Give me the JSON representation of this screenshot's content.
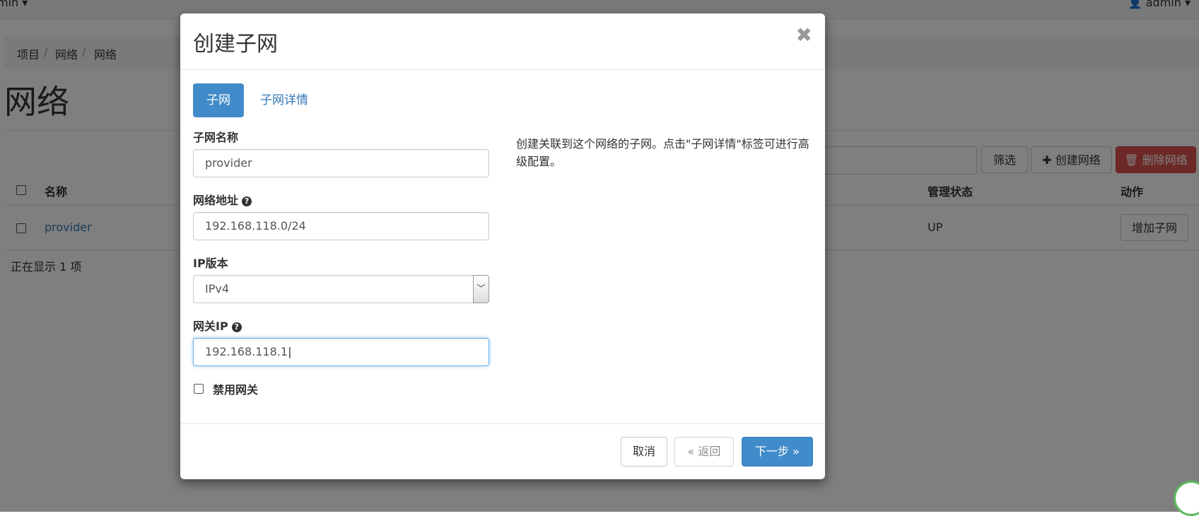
{
  "topbar": {
    "left_label": "min ▾",
    "right_label": "admin ▾"
  },
  "breadcrumb": [
    "项目",
    "网络",
    "网络"
  ],
  "page": {
    "title": "网络"
  },
  "toolbar": {
    "filter_label": "筛选",
    "create_label": "✚ 创建网络",
    "delete_label": "🗑 删除网络"
  },
  "table": {
    "headers": {
      "name": "名称",
      "admin_state": "管理状态",
      "actions": "动作"
    },
    "rows": [
      {
        "name": "provider",
        "admin_state": "UP",
        "action": "增加子网"
      }
    ],
    "footer": "正在显示 1 项"
  },
  "modal": {
    "title": "创建子网",
    "close_glyph": "✖",
    "tabs": [
      {
        "label": "子网"
      },
      {
        "label": "子网详情"
      }
    ],
    "fields": {
      "subnet_name": {
        "label": "子网名称",
        "value": "provider"
      },
      "network_address": {
        "label": "网络地址",
        "value": "192.168.118.0/24"
      },
      "ip_version": {
        "label": "IP版本",
        "value": "IPv4"
      },
      "gateway_ip": {
        "label": "网关IP",
        "value": "192.168.118.1"
      },
      "disable_gateway": {
        "label": "禁用网关",
        "checked": false
      }
    },
    "help_text": "创建关联到这个网络的子网。点击\"子网详情\"标签可进行高级配置。",
    "buttons": {
      "cancel": "取消",
      "back": "« 返回",
      "next": "下一步 »"
    }
  },
  "colors": {
    "primary": "#428bca",
    "danger": "#d9534f",
    "link": "#337ab7"
  }
}
